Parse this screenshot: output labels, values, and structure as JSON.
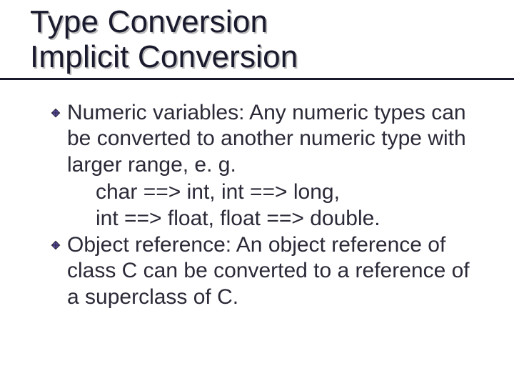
{
  "title": {
    "line1": "Type Conversion",
    "line2": "Implicit Conversion"
  },
  "bullets": [
    {
      "lead": "Numeric variables: Any numeric types can be converted to another numeric type with larger range,  e. g.",
      "sub": [
        "char ==> int, int ==> long,",
        "int ==> float, float ==> double."
      ]
    },
    {
      "lead": "Object reference: An object reference of class C can be converted to a reference of a superclass of C.",
      "sub": []
    }
  ],
  "colors": {
    "bullet_fill": "#5a4aa8",
    "bullet_border": "#2a2a38"
  }
}
